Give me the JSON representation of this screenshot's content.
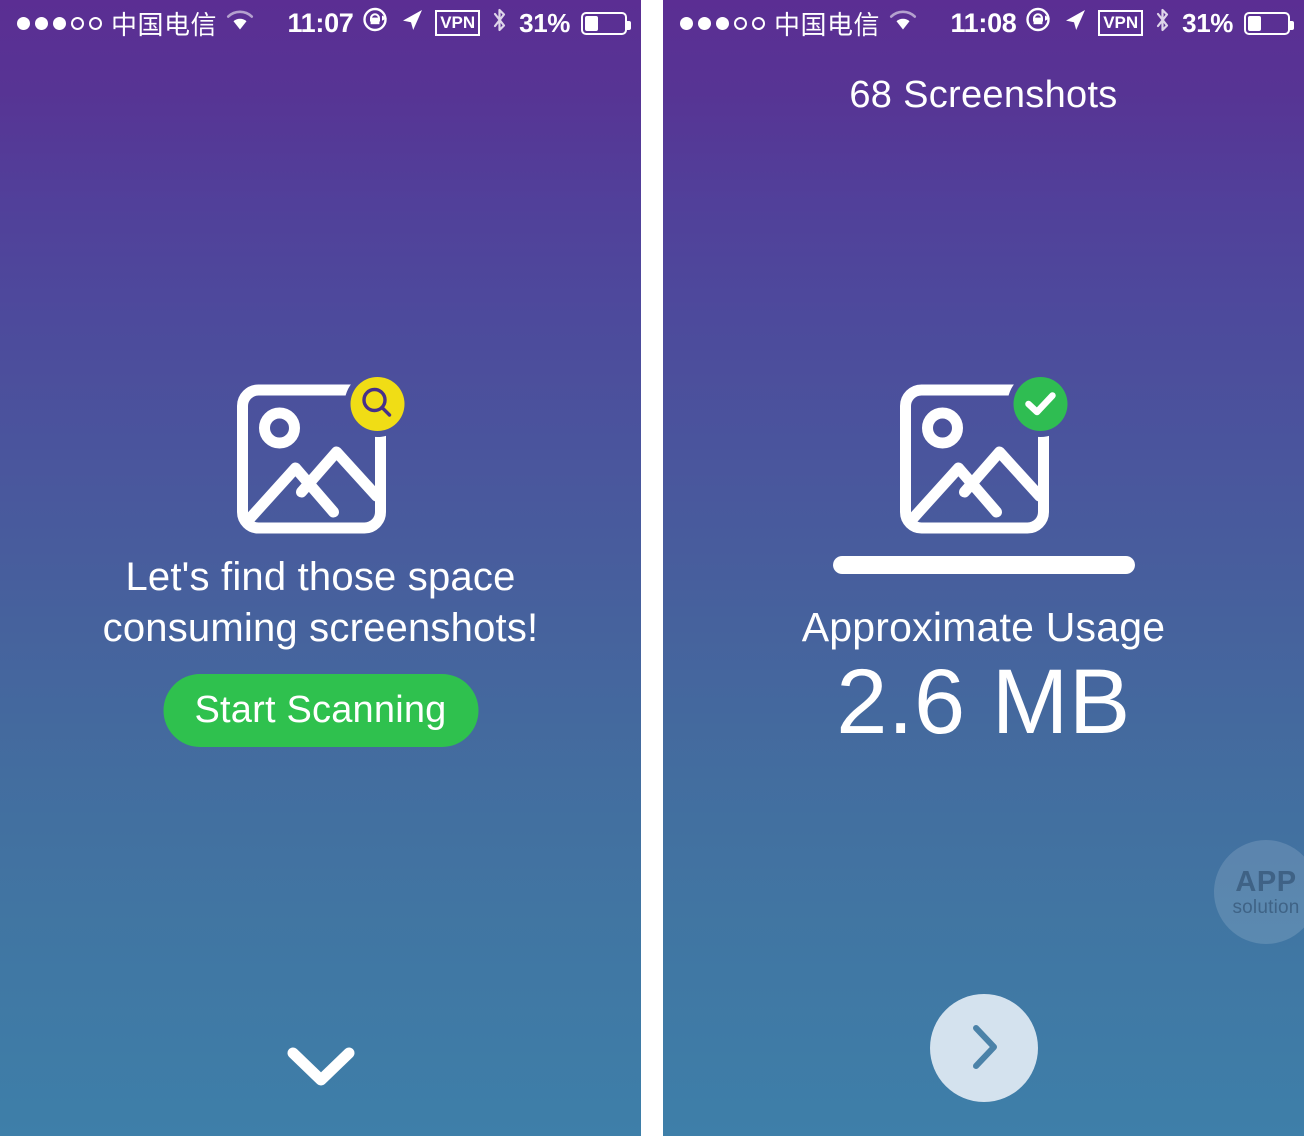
{
  "left_screen": {
    "status_bar": {
      "signal_dots_filled": 3,
      "signal_dots_total": 5,
      "carrier": "中国电信",
      "wifi": "wifi-icon",
      "time": "11:07",
      "rotation_lock": "rotation-lock-icon",
      "location": "location-arrow-icon",
      "vpn": "VPN",
      "bluetooth": "bluetooth-icon",
      "battery_percent": "31%"
    },
    "photo_icon": {
      "name": "photo-placeholder-icon",
      "badge": "search-badge-icon",
      "badge_color": "#f0dd15"
    },
    "tagline_line1": "Let's find those space",
    "tagline_line2": "consuming screenshots!",
    "scan_button": {
      "label": "Start Scanning",
      "color": "#2fc14e"
    },
    "scroll_hint": "chevron-down-icon"
  },
  "right_screen": {
    "status_bar": {
      "signal_dots_filled": 3,
      "signal_dots_total": 5,
      "carrier": "中国电信",
      "wifi": "wifi-icon",
      "time": "11:08",
      "rotation_lock": "rotation-lock-icon",
      "location": "location-arrow-icon",
      "vpn": "VPN",
      "bluetooth": "bluetooth-icon",
      "battery_percent": "31%"
    },
    "title": "68 Screenshots",
    "photo_icon": {
      "name": "photo-placeholder-icon",
      "badge": "check-badge-icon",
      "badge_color": "#2fbd52"
    },
    "progress_percent": 100,
    "usage_label": "Approximate Usage",
    "usage_value": "2.6 MB",
    "next_button": "chevron-right-icon",
    "watermark": {
      "line1": "APP",
      "line2": "solution"
    }
  },
  "theme": {
    "gradient_top": "#5b2e93",
    "gradient_bottom": "#3e7fa9",
    "accent_green": "#2fc14e",
    "accent_yellow": "#f0dd15",
    "next_button_bg": "#d4e2ee",
    "next_button_arrow": "#4b82a8"
  }
}
